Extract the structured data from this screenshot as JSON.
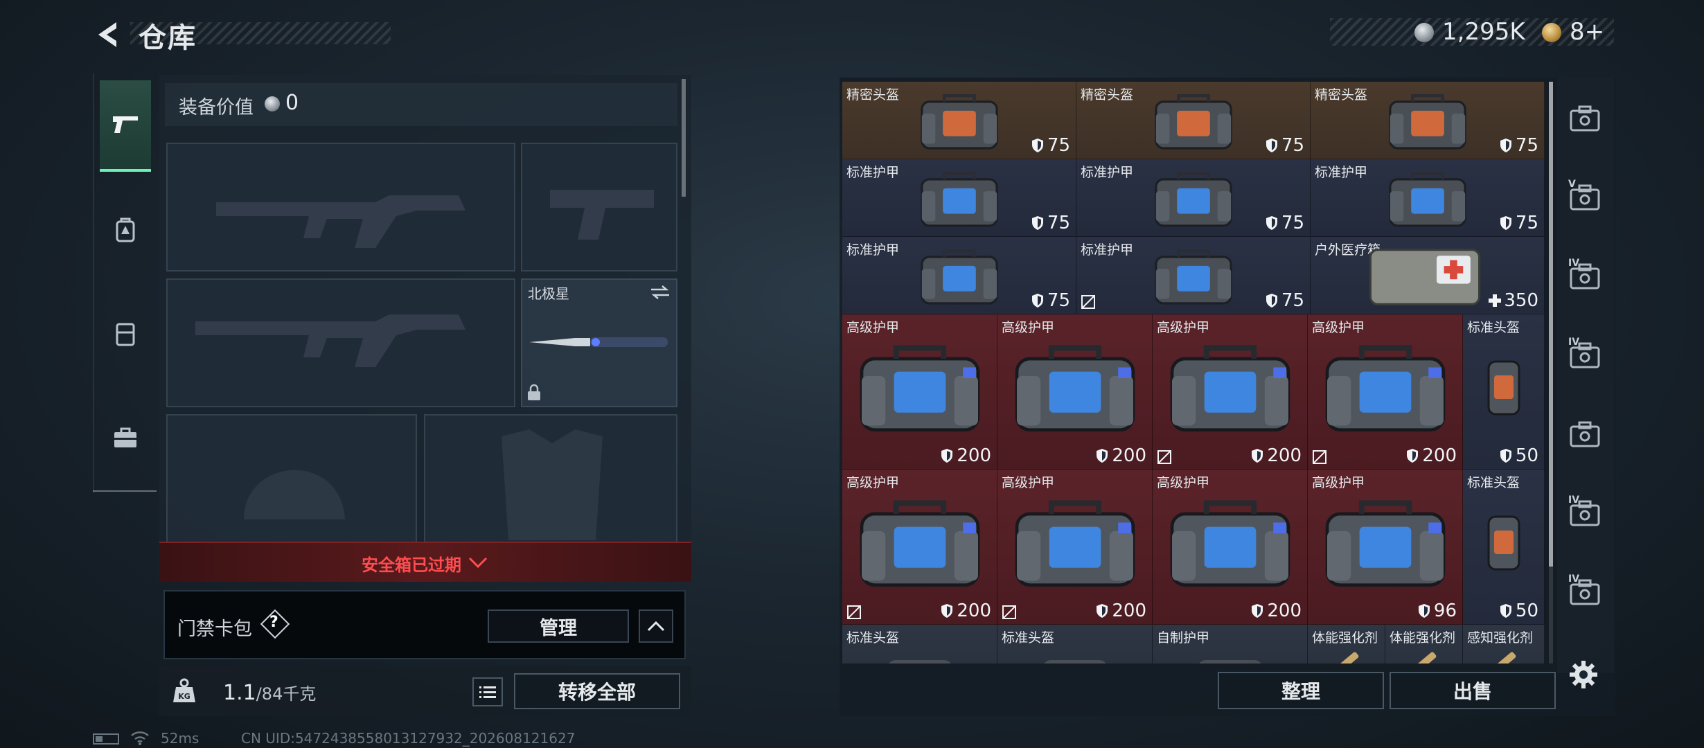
{
  "header": {
    "title": "仓库",
    "coins": "1,295K",
    "tickets": "8+"
  },
  "left_tabs": [
    {
      "icon": "pistol-icon",
      "active": true
    },
    {
      "icon": "backpack-icon",
      "active": false
    },
    {
      "icon": "vest-icon",
      "active": false
    },
    {
      "icon": "toolbox-icon",
      "active": false
    }
  ],
  "equipment": {
    "value_label": "装备价值",
    "value": "0",
    "melee_name": "北极星",
    "safebox_status": "安全箱已过期",
    "card_label": "门禁卡包",
    "card_help": "?",
    "manage_label": "管理",
    "weight_value": "1.1",
    "weight_max": "/84千克",
    "transfer_label": "转移全部"
  },
  "status": {
    "ping": "52ms",
    "uid": "CN UID:5472438558013127932_202608121627"
  },
  "storage": {
    "sort_label": "整理",
    "sell_label": "出售",
    "items": [
      {
        "name": "精密头盔",
        "dur": "75",
        "bg": "brown",
        "kind": "helmet-bag",
        "broken": false
      },
      {
        "name": "精密头盔",
        "dur": "75",
        "bg": "brown",
        "kind": "helmet-bag",
        "broken": false
      },
      {
        "name": "精密头盔",
        "dur": "75",
        "bg": "brown",
        "kind": "helmet-bag",
        "broken": false
      },
      {
        "name": "标准护甲",
        "dur": "75",
        "bg": "blue",
        "kind": "armor-bag",
        "broken": false
      },
      {
        "name": "标准护甲",
        "dur": "75",
        "bg": "blue",
        "kind": "armor-bag",
        "broken": false
      },
      {
        "name": "标准护甲",
        "dur": "75",
        "bg": "blue",
        "kind": "armor-bag",
        "broken": false
      },
      {
        "name": "标准护甲",
        "dur": "75",
        "bg": "blue",
        "kind": "armor-bag",
        "broken": false
      },
      {
        "name": "标准护甲",
        "dur": "75",
        "bg": "blue",
        "kind": "armor-bag",
        "broken": true
      },
      {
        "name": "户外医疗箱",
        "dur": "350",
        "bg": "blue",
        "kind": "medkit",
        "broken": false
      },
      {
        "name": "高级护甲",
        "dur": "200",
        "bg": "red",
        "kind": "big-armor",
        "broken": false
      },
      {
        "name": "高级护甲",
        "dur": "200",
        "bg": "red",
        "kind": "big-armor",
        "broken": false
      },
      {
        "name": "高级护甲",
        "dur": "200",
        "bg": "red",
        "kind": "big-armor",
        "broken": true
      },
      {
        "name": "高级护甲",
        "dur": "200",
        "bg": "red",
        "kind": "big-armor",
        "broken": true
      },
      {
        "name": "标准头盔",
        "dur": "50",
        "bg": "blue",
        "kind": "helmet",
        "broken": false
      },
      {
        "name": "高级护甲",
        "dur": "200",
        "bg": "red",
        "kind": "big-armor",
        "broken": true
      },
      {
        "name": "高级护甲",
        "dur": "200",
        "bg": "red",
        "kind": "big-armor",
        "broken": true
      },
      {
        "name": "高级护甲",
        "dur": "200",
        "bg": "red",
        "kind": "big-armor",
        "broken": false
      },
      {
        "name": "高级护甲",
        "dur": "96",
        "bg": "red",
        "kind": "big-armor",
        "broken": false
      },
      {
        "name": "标准头盔",
        "dur": "50",
        "bg": "blue",
        "kind": "helmet",
        "broken": false
      },
      {
        "name": "标准头盔",
        "dur": "",
        "bg": "gray",
        "kind": "helmet-partial",
        "broken": false
      },
      {
        "name": "标准头盔",
        "dur": "",
        "bg": "gray",
        "kind": "helmet-partial",
        "broken": false
      },
      {
        "name": "自制护甲",
        "dur": "",
        "bg": "gray",
        "kind": "crate-partial",
        "broken": false
      },
      {
        "name": "体能强化剂",
        "dur": "",
        "bg": "gray",
        "kind": "syringe",
        "broken": false
      },
      {
        "name": "体能强化剂",
        "dur": "",
        "bg": "gray",
        "kind": "syringe",
        "broken": false
      },
      {
        "name": "感知强化剂",
        "dur": "",
        "bg": "gray",
        "kind": "syringe",
        "broken": false
      }
    ]
  },
  "right_tabs": [
    {
      "icon": "helmet-tab-icon",
      "label": ""
    },
    {
      "icon": "case-v-icon",
      "label": "V"
    },
    {
      "icon": "case-iv-helmet-icon",
      "label": "IV"
    },
    {
      "icon": "case-iv-medical-icon",
      "label": "IV"
    },
    {
      "icon": "case-icon",
      "label": ""
    },
    {
      "icon": "case-iv-folder-icon",
      "label": "IV"
    },
    {
      "icon": "case-iv-box-icon",
      "label": "IV"
    }
  ],
  "colors": {
    "accent": "#6ff0b7",
    "alert": "#ff4d4f"
  }
}
